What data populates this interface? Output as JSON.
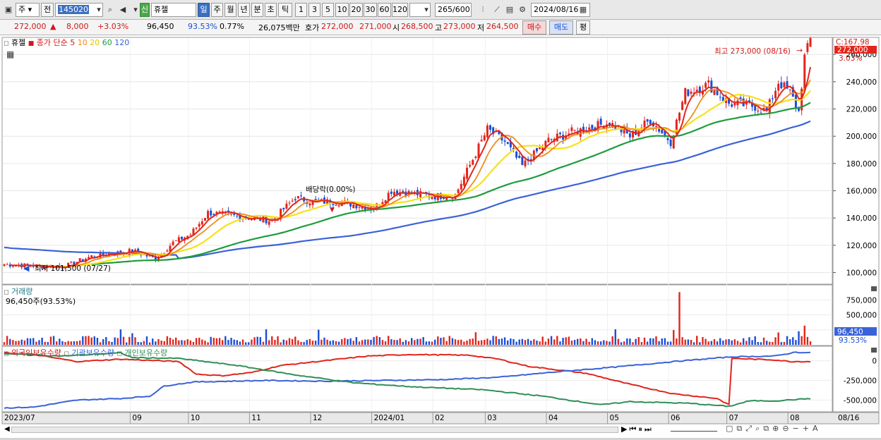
{
  "toolbar": {
    "market": "주",
    "prev": "전",
    "code": "145020",
    "new_badge": "신",
    "stock_name": "휴젤",
    "periods": [
      "일",
      "주",
      "월",
      "년",
      "분",
      "초",
      "틱"
    ],
    "selected_period": "일",
    "intervals": [
      "1",
      "3",
      "5",
      "10",
      "20",
      "30",
      "60",
      "120"
    ],
    "count": "265",
    "count_max": "/600",
    "date": "2024/08/16"
  },
  "quote": {
    "price": "272,000",
    "change": "8,000",
    "change_pct": "+3.03%",
    "volume": "96,450",
    "vol_ratio": "93.53%",
    "turnover": "0.77%",
    "amount": "26,075백만",
    "bid_label": "호가",
    "bid": "272,000",
    "ask": "271,000",
    "open_label": "시",
    "open": "268,500",
    "high_label": "고",
    "high": "273,000",
    "low_label": "저",
    "low": "264,500",
    "buy": "매수",
    "sell": "매도",
    "eval": "평"
  },
  "chart_data": {
    "type": "candlestick",
    "title": "휴젤",
    "legend": {
      "price": "종가 단순",
      "ma_periods": [
        "5",
        "10",
        "20",
        "60",
        "120"
      ],
      "volume": "거래량",
      "volume_value": "96,450주(93.53%)",
      "holdings": [
        "외국인보유수량",
        "기관보유수량",
        "개인보유수량"
      ]
    },
    "colors": {
      "up": "#e1261c",
      "down": "#1a4ed8",
      "ma5": "#e1261c",
      "ma10": "#f08c1e",
      "ma20": "#f5e21a",
      "ma60": "#1e9c3c",
      "ma120": "#3a62d8",
      "foreign": "#e1261c",
      "institution": "#3a62d8",
      "individual": "#2f8f57"
    },
    "price_ticks": [
      100000,
      120000,
      140000,
      160000,
      180000,
      200000,
      220000,
      240000,
      260000
    ],
    "price_tick_labels": [
      "100,000",
      "120,000",
      "140,000",
      "160,000",
      "180,000",
      "200,000",
      "220,000",
      "240,000",
      "260,000"
    ],
    "price_ylim": [
      92000,
      272000
    ],
    "current_price": "272,000",
    "current_pct": "3.03%",
    "axis_top_label": "C:167.98",
    "annotations": {
      "high": "최고 273,000 (08/16)",
      "low": "최저 101,500 (07/27)",
      "dividend": "배당락(0.00%)"
    },
    "volume_ticks": [
      "750,000",
      "500,000",
      "250,000"
    ],
    "volume_tick_values": [
      750000,
      500000,
      250000
    ],
    "volume_ylim": [
      0,
      930000
    ],
    "volume_current": "96,450",
    "volume_current_pct": "93.53%",
    "holdings_ticks": [
      "0",
      "-250,000",
      "-500,000"
    ],
    "holdings_tick_values": [
      0,
      -250000,
      -500000
    ],
    "holdings_ylim": [
      -640000,
      140000
    ],
    "x_labels": [
      "2023/07",
      "09",
      "10",
      "11",
      "12",
      "2024/01",
      "02",
      "03",
      "04",
      "05",
      "06",
      "07",
      "08"
    ],
    "x_label_index": [
      0,
      44,
      64,
      85,
      106,
      127,
      148,
      166,
      187,
      208,
      229,
      249,
      270
    ],
    "x_last_label": "08/16",
    "monthly_close": [
      {
        "month": "2023/07",
        "close": 106000
      },
      {
        "month": "2023/08",
        "close": 113000
      },
      {
        "month": "2023/09",
        "close": 122000
      },
      {
        "month": "2023/10",
        "close": 140000
      },
      {
        "month": "2023/11",
        "close": 148000
      },
      {
        "month": "2023/12",
        "close": 151000
      },
      {
        "month": "2024/01",
        "close": 158000
      },
      {
        "month": "2024/02",
        "close": 160000
      },
      {
        "month": "2024/03",
        "close": 188000
      },
      {
        "month": "2024/04",
        "close": 205000
      },
      {
        "month": "2024/05",
        "close": 202000
      },
      {
        "month": "2024/06",
        "close": 238000
      },
      {
        "month": "2024/07",
        "close": 220000
      },
      {
        "month": "2024/08",
        "close": 272000
      }
    ]
  }
}
